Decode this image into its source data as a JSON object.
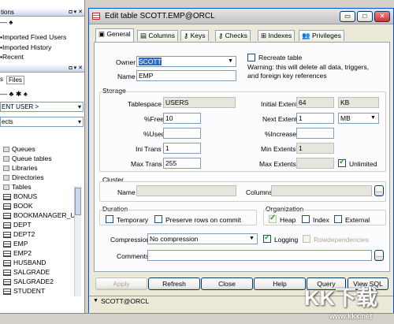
{
  "left_panel": {
    "top_header": "tions",
    "top_items": [
      "Imported Fixed Users",
      "Imported History",
      "Recent"
    ],
    "files_tab": "s",
    "files_tab2": "Files",
    "current_user": "ENT USER >",
    "objects": "ects",
    "tree": [
      "Queues",
      "Queue tables",
      "Libraries",
      "Directories",
      "Tables"
    ],
    "tables": [
      "BONUS",
      "BOOK",
      "BOOKMANAGER_U",
      "DEPT",
      "DEPT2",
      "EMP",
      "EMP2",
      "HUSBAND",
      "SALGRADE",
      "SALGRADE2",
      "STUDENT"
    ]
  },
  "dialog": {
    "title": "Edit table SCOTT.EMP@ORCL",
    "tabs": [
      "General",
      "Columns",
      "Keys",
      "Checks",
      "Indexes",
      "Privileges"
    ],
    "owner_label": "Owner",
    "owner_value": "SCOTT",
    "recreate_label": "Recreate table",
    "warning": "Warning: this will delete all data, triggers, and foreign key references",
    "name_label": "Name",
    "name_value": "EMP",
    "storage_label": "Storage",
    "tablespace_label": "Tablespace",
    "tablespace_value": "USERS",
    "initial_extent_label": "Initial Extent",
    "initial_extent_value": "64",
    "initial_extent_unit": "KB",
    "pctfree_label": "%Free",
    "pctfree_value": "10",
    "next_extent_label": "Next Extent",
    "next_extent_value": "1",
    "next_extent_unit": "MB",
    "pctused_label": "%Used",
    "pctused_value": "",
    "pctincrease_label": "%Increase",
    "pctincrease_value": "",
    "initrans_label": "Ini Trans",
    "initrans_value": "1",
    "minextents_label": "Min Extents",
    "minextents_value": "1",
    "maxtrans_label": "Max Trans",
    "maxtrans_value": "255",
    "maxextents_label": "Max Extents",
    "maxextents_value": "",
    "unlimited_label": "Unlimited",
    "cluster_label": "Cluster",
    "cluster_name_label": "Name",
    "cluster_columns_label": "Columns",
    "duration_label": "Duration",
    "temporary_label": "Temporary",
    "preserve_label": "Preserve rows on commit",
    "organization_label": "Organization",
    "heap_label": "Heap",
    "index_label": "Index",
    "external_label": "External",
    "compression_label": "Compression",
    "compression_value": "No compression",
    "logging_label": "Logging",
    "rowdep_label": "Rowdependencies",
    "comments_label": "Comments",
    "buttons": {
      "apply": "Apply",
      "refresh": "Refresh",
      "close": "Close",
      "help": "Help",
      "query": "Query",
      "viewsql": "View SQL"
    },
    "status": "SCOTT@ORCL"
  },
  "watermark": {
    "brand": "KK下载",
    "url": "www.kkx.net"
  }
}
